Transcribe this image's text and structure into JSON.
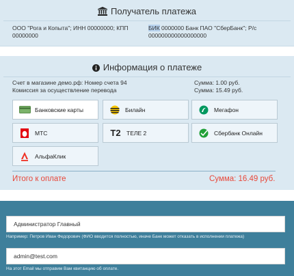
{
  "recipient": {
    "title": "Получатель платежа",
    "left_text": "ООО \"Рога и Копыта\"; ИНН 00000000; КПП 00000000",
    "right_text_highlight": "БИК",
    "right_text": " 0000000 Банк ПАО \"СберБанк\"; Р/с 000000000000000000"
  },
  "info": {
    "title": "Информация о платеже",
    "order_line": "Счет в магазине демо.рф: Номер счета 94",
    "fee_line": "Комиссия за осуществление перевода",
    "order_sum": "Сумма: 1.00 руб.",
    "fee_sum": "Сумма: 15.49 руб."
  },
  "methods": [
    {
      "label": "Банковские карты",
      "icon": "bank-card-icon",
      "active": true
    },
    {
      "label": "Билайн",
      "icon": "beeline-icon",
      "active": false
    },
    {
      "label": "Мегафон",
      "icon": "megafon-icon",
      "active": false
    },
    {
      "label": "МТС",
      "icon": "mts-icon",
      "active": false
    },
    {
      "label": "ТЕЛЕ 2",
      "icon": "tele2-icon",
      "active": false
    },
    {
      "label": "Сбербанк Онлайн",
      "icon": "sberbank-icon",
      "active": false
    },
    {
      "label": "АльфаКлик",
      "icon": "alfaclick-icon",
      "active": false
    }
  ],
  "total": {
    "label": "Итого к оплате",
    "amount": "Сумма: 16.49 руб."
  },
  "form": {
    "name_value": "Администратор Главный",
    "name_hint": "Например: Петров Иван Федорович (ФИО вводится полностью, иначе Банк может отказать в исполнении платежа)",
    "email_value": "admin@test.com",
    "email_hint": "На этот Email мы отправим Вам квитанцию об оплате."
  },
  "colors": {
    "panel_bg": "#dbe9f2",
    "accent_red": "#e8483a",
    "dark_bg": "#3e7f9b"
  }
}
